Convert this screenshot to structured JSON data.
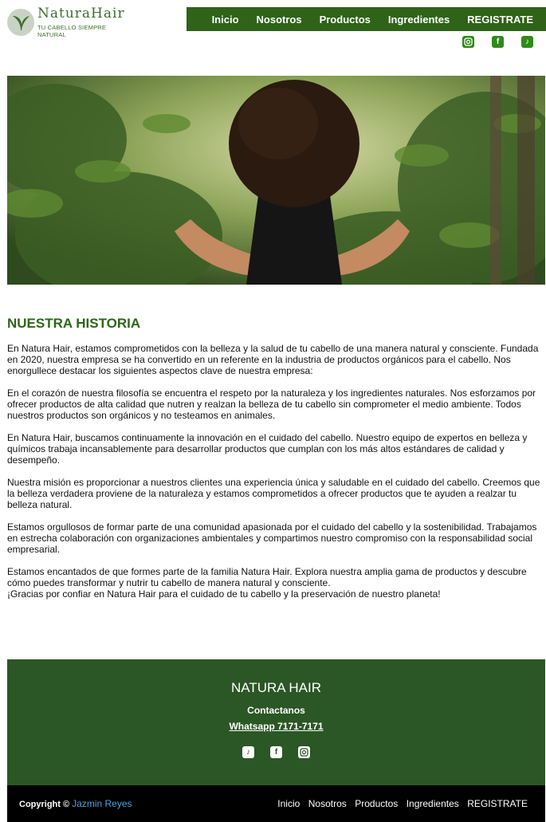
{
  "brand": {
    "name": "NaturaHair",
    "tagline": "TU CABELLO SIEMPRE NATURAL"
  },
  "nav": [
    "Inicio",
    "Nosotros",
    "Productos",
    "Ingredientes",
    "REGISTRATE"
  ],
  "social_icons": [
    "instagram-icon",
    "facebook-icon",
    "tiktok-icon"
  ],
  "colors": {
    "nav_bg": "#2e6318",
    "heading": "#2f6519",
    "footer_bg": "#2b5625",
    "bottom_bg": "#000000",
    "author_link": "#4aa3e0"
  },
  "main": {
    "title": "NUESTRA HISTORIA",
    "paragraphs": [
      "En Natura Hair, estamos comprometidos con la belleza y la salud de tu cabello de una manera natural y consciente. Fundada en 2020, nuestra empresa se ha convertido en un referente en la industria de productos orgánicos para el cabello. Nos enorgullece destacar los siguientes aspectos clave de nuestra empresa:",
      "En el corazón de nuestra filosofía se encuentra el respeto por la naturaleza y los ingredientes naturales. Nos esforzamos por ofrecer productos de alta calidad que nutren y realzan la belleza de tu cabello sin comprometer el medio ambiente. Todos nuestros productos son orgánicos y no testeamos en animales.",
      "En Natura Hair, buscamos continuamente la innovación en el cuidado del cabello. Nuestro equipo de expertos en belleza y químicos trabaja incansablemente para desarrollar productos que cumplan con los más altos estándares de calidad y desempeño.",
      "Nuestra misión es proporcionar a nuestros clientes una experiencia única y saludable en el cuidado del cabello. Creemos que la belleza verdadera proviene de la naturaleza y estamos comprometidos a ofrecer productos que te ayuden a realzar tu belleza natural.",
      "Estamos orgullosos de formar parte de una comunidad apasionada por el cuidado del cabello y la sostenibilidad. Trabajamos en estrecha colaboración con organizaciones ambientales y compartimos nuestro compromiso con la responsabilidad social empresarial."
    ],
    "closing_1": "Estamos encantados de que formes parte de la familia Natura Hair. Explora nuestra amplia gama de productos y descubre cómo puedes transformar y nutrir tu cabello de manera natural y consciente.",
    "closing_2": "¡Gracias por confiar en Natura Hair para el cuidado de tu cabello y la preservación de nuestro planeta!"
  },
  "footer": {
    "brand": "NATURA HAIR",
    "contact_label": "Contactanos",
    "whatsapp": "Whatsapp 7171-7171",
    "social_icons": [
      "tiktok-icon",
      "facebook-icon",
      "instagram-icon"
    ]
  },
  "bottom": {
    "copyright": "Copyright ©",
    "author": "Jazmin Reyes",
    "nav": [
      "Inicio",
      "Nosotros",
      "Productos",
      "Ingredientes",
      "REGISTRATE"
    ]
  }
}
